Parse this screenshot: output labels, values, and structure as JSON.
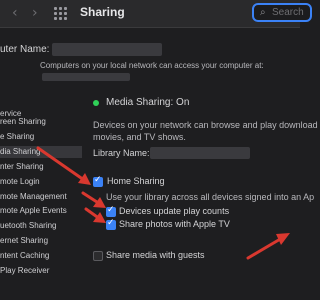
{
  "window": {
    "title": "Sharing",
    "back_icon": "chevron-left-icon",
    "forward_icon": "chevron-right-icon"
  },
  "search": {
    "placeholder": "Search"
  },
  "computer_name": {
    "label": "uter Name:",
    "description": "Computers on your local network can access your computer at:"
  },
  "services": {
    "header": "ervice",
    "items": [
      {
        "label": "reen Sharing",
        "selected": false
      },
      {
        "label": "e Sharing",
        "selected": false
      },
      {
        "label": "dia Sharing",
        "selected": true
      },
      {
        "label": "nter Sharing",
        "selected": false
      },
      {
        "label": "mote Login",
        "selected": false
      },
      {
        "label": "mote Management",
        "selected": false
      },
      {
        "label": "mote Apple Events",
        "selected": false
      },
      {
        "label": "uetooth Sharing",
        "selected": false
      },
      {
        "label": "ernet Sharing",
        "selected": false
      },
      {
        "label": "ntent Caching",
        "selected": false
      },
      {
        "label": "Play Receiver",
        "selected": false
      }
    ]
  },
  "detail": {
    "status": "Media Sharing: On",
    "status_color": "#30d158",
    "description_line1": "Devices on your network can browse and play download",
    "description_line2": "movies, and TV shows.",
    "library_label": "Library Name:",
    "home_sharing": {
      "label": "Home Sharing",
      "checked": true
    },
    "home_sharing_sub": "Use your library across all devices signed into an Ap",
    "devices_update": {
      "label": "Devices update play counts",
      "checked": true
    },
    "share_photos": {
      "label": "Share photos with Apple TV",
      "checked": true
    },
    "share_guests": {
      "label": "Share media with guests",
      "checked": false
    }
  },
  "colors": {
    "accent": "#3b82f6",
    "annotation_arrow": "#d9382f"
  }
}
